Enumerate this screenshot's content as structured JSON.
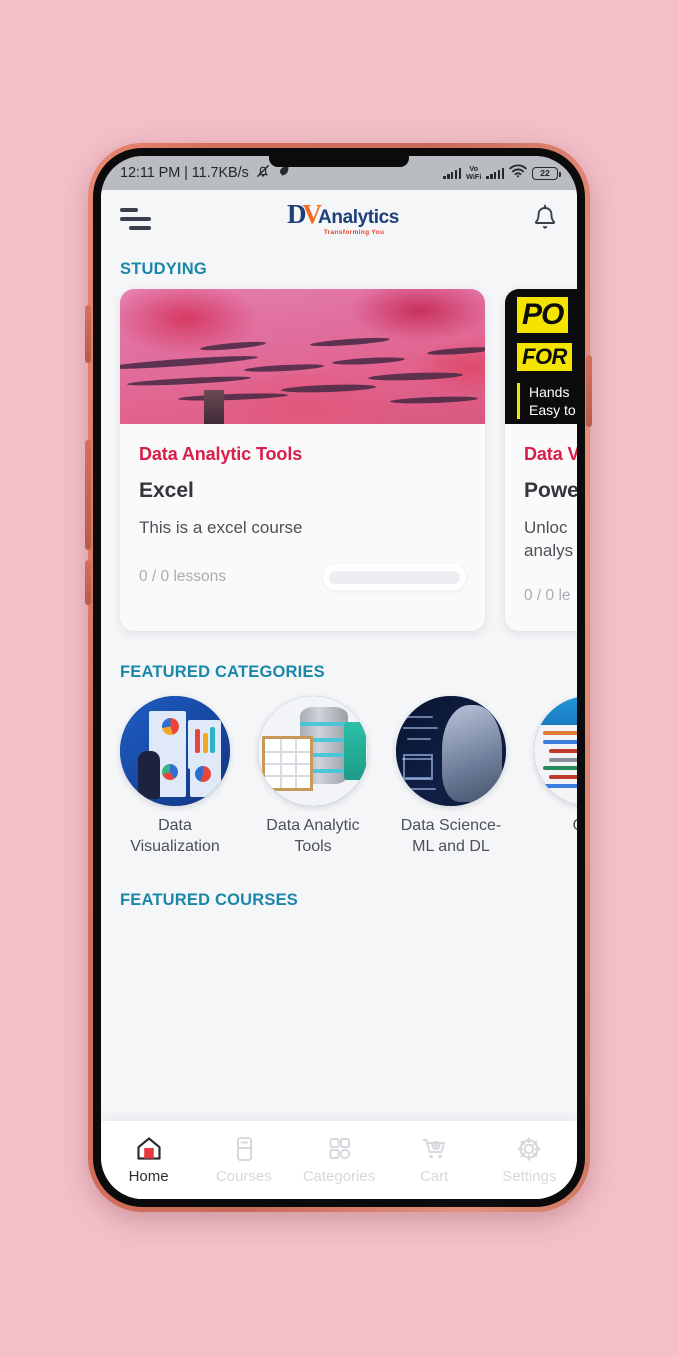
{
  "status_bar": {
    "time_and_rate": "12:11 PM | 11.7KB/s",
    "mute_icon": "mute-bell-icon",
    "leaf_icon": "leaf-icon",
    "vo_label": "Vo",
    "wifi_label": "WiFi",
    "battery_level": "22"
  },
  "header": {
    "menu_icon": "hamburger-menu-icon",
    "logo": {
      "d": "D",
      "v": "V",
      "analytics": "Analytics",
      "tagline": "Transforming You"
    },
    "notification_icon": "bell-icon"
  },
  "studying": {
    "title": "STUDYING",
    "cards": [
      {
        "category": "Data Analytic Tools",
        "title": "Excel",
        "description": "This is a excel course",
        "lessons": "0 / 0 lessons",
        "progress_percent": 0,
        "hero_type": "sunset-sky-image"
      },
      {
        "category": "Data V",
        "title": "Powe",
        "description_line1": "Unloc",
        "description_line2": "analys",
        "lessons": "0 / 0 le",
        "hero_type": "power-bi-poster",
        "hero_text": {
          "line1": "PO",
          "line2": "FOR",
          "sub1": "Hands",
          "sub2": "Easy to"
        }
      }
    ]
  },
  "featured_categories": {
    "title": "FEATURED CATEGORIES",
    "items": [
      {
        "label": "Data Visualization",
        "thumb": "dashboard-charts-image"
      },
      {
        "label": "Data Analytic Tools",
        "thumb": "database-spreadsheet-image"
      },
      {
        "label": "Data Science-ML and DL",
        "thumb": "robot-formulas-image"
      },
      {
        "label": "Codi",
        "thumb": "code-editor-image"
      }
    ]
  },
  "featured_courses": {
    "title": "FEATURED COURSES"
  },
  "tabbar": {
    "items": [
      {
        "label": "Home",
        "icon": "home-icon",
        "active": true
      },
      {
        "label": "Courses",
        "icon": "book-icon",
        "active": false
      },
      {
        "label": "Categories",
        "icon": "grid-icon",
        "active": false
      },
      {
        "label": "Cart",
        "icon": "cart-plus-icon",
        "active": false
      },
      {
        "label": "Settings",
        "icon": "gear-icon",
        "active": false
      }
    ]
  },
  "colors": {
    "accent_teal": "#1b87a8",
    "category_crimson": "#d81e4a",
    "home_red": "#e8393f",
    "logo_navy": "#1d3f7a",
    "logo_orange": "#f26a22",
    "page_background": "#f4bfc9"
  }
}
